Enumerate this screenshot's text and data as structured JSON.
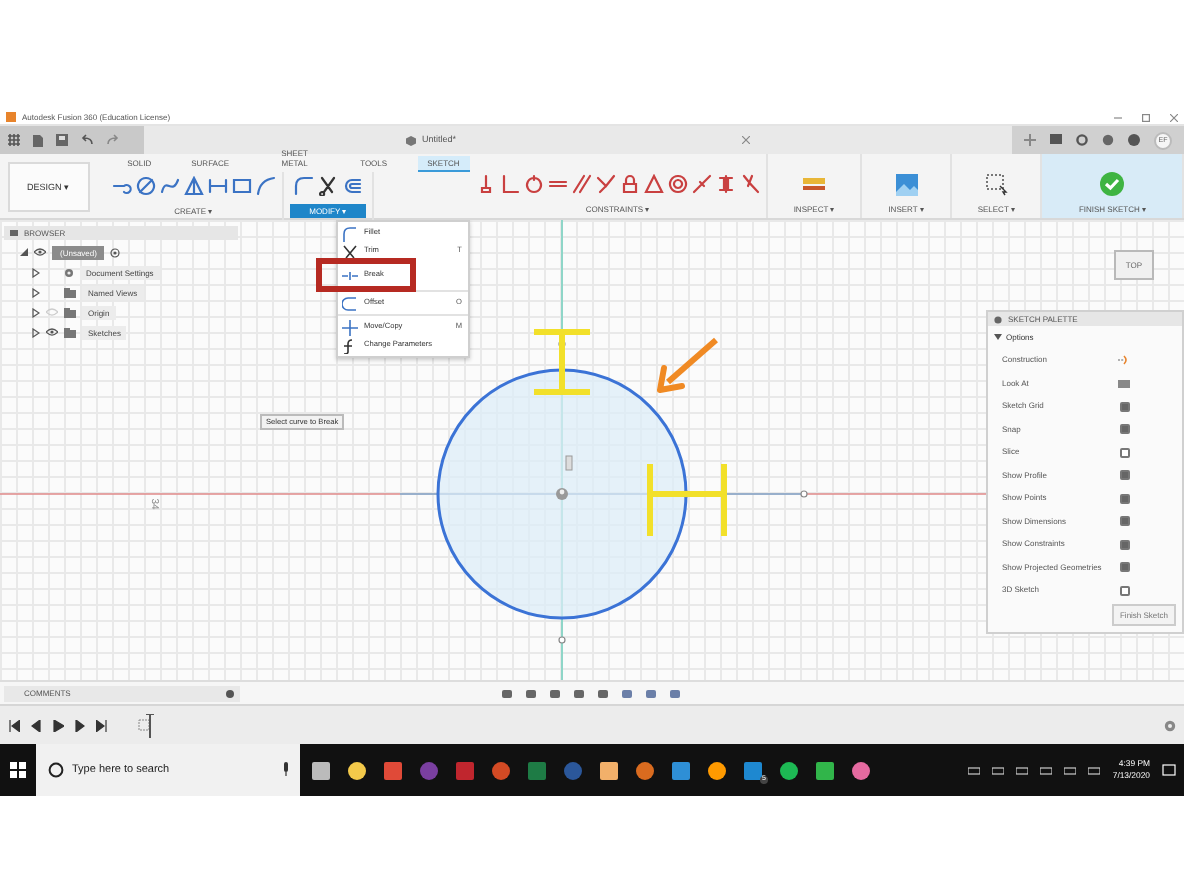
{
  "title_bar": {
    "title": "Autodesk Fusion 360 (Education License)"
  },
  "app_bar": {
    "document_tab": "Untitled*",
    "avatar": "EF"
  },
  "toolbar": {
    "workspace": "DESIGN ▾",
    "tabs": [
      {
        "label": "SOLID",
        "selected": false
      },
      {
        "label": "SURFACE",
        "selected": false
      },
      {
        "label": "SHEET METAL",
        "selected": false
      },
      {
        "label": "TOOLS",
        "selected": false
      },
      {
        "label": "SKETCH",
        "selected": true
      }
    ],
    "groups": [
      {
        "kind": "create",
        "label": "CREATE ▾",
        "selected": false
      },
      {
        "kind": "modify",
        "label": "MODIFY ▾",
        "selected": true
      },
      {
        "kind": "constraints",
        "label": "CONSTRAINTS ▾",
        "selected": false
      },
      {
        "kind": "inspect",
        "label": "INSPECT ▾",
        "selected": false
      },
      {
        "kind": "insert",
        "label": "INSERT ▾",
        "selected": false
      },
      {
        "kind": "select",
        "label": "SELECT ▾",
        "selected": false
      },
      {
        "kind": "finish",
        "label": "FINISH SKETCH ▾",
        "selected": false
      }
    ]
  },
  "modify_menu": [
    {
      "kind": "fillet",
      "label": "Fillet",
      "highlighted": false
    },
    {
      "kind": "trim",
      "label": "Trim",
      "shortcut": "T",
      "highlighted": false
    },
    {
      "kind": "break",
      "label": "Break",
      "highlighted": true
    },
    {
      "kind": "offset",
      "label": "Offset",
      "shortcut": "O",
      "highlighted": false
    },
    {
      "kind": "move",
      "label": "Move/Copy",
      "shortcut": "M",
      "highlighted": false
    },
    {
      "kind": "parameters",
      "label": "Change Parameters",
      "highlighted": false
    }
  ],
  "browser": {
    "title": "BROWSER",
    "root": "(Unsaved)",
    "children": [
      {
        "kind": "gear",
        "label": "Document Settings"
      },
      {
        "kind": "folder",
        "label": "Named Views"
      },
      {
        "kind": "folder",
        "label": "Origin",
        "eye": {
          "visible": false
        }
      },
      {
        "kind": "folder",
        "label": "Sketches",
        "eye": {
          "visible": true
        }
      }
    ]
  },
  "canvas": {
    "tooltip": "Select curve to Break",
    "viewcube": "TOP",
    "dimension": "34"
  },
  "sketch_palette": {
    "title": "SKETCH PALETTE",
    "section": "Options",
    "expanded": true,
    "tools": [
      {
        "kind": "construction",
        "label": "Construction"
      },
      {
        "kind": "look",
        "label": "Look At"
      }
    ],
    "options": [
      {
        "label": "Sketch Grid",
        "checked": true
      },
      {
        "label": "Snap",
        "checked": true
      },
      {
        "label": "Slice",
        "checked": false
      },
      {
        "label": "Show Profile",
        "checked": true
      },
      {
        "label": "Show Points",
        "checked": true
      },
      {
        "label": "Show Dimensions",
        "checked": true
      },
      {
        "label": "Show Constraints",
        "checked": true
      },
      {
        "label": "Show Projected Geometries",
        "checked": true
      },
      {
        "label": "3D Sketch",
        "checked": false
      }
    ],
    "button": "Finish Sketch"
  },
  "comments": {
    "title": "COMMENTS"
  },
  "taskbar": {
    "search_placeholder": "Type here to search",
    "badge": "5",
    "time": "4:39 PM",
    "date": "7/13/2020"
  }
}
